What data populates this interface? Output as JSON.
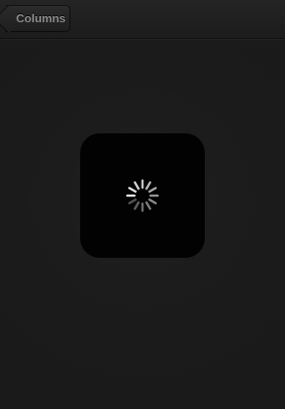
{
  "navbar": {
    "back_label": "Columns"
  },
  "loading": {
    "icon": "activity-spinner-icon",
    "hud_color": "#020202"
  },
  "colors": {
    "background": "#1b1b1b",
    "text_muted": "#8a8a8a"
  }
}
